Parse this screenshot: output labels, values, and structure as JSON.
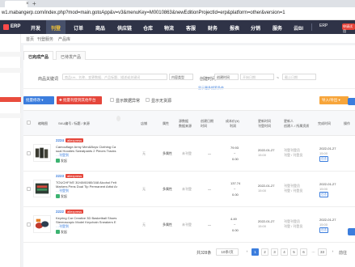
{
  "browser": {
    "close_glyph": "×",
    "new_tab_glyph": "+",
    "url": "w1.mabangerp.com/index.php?mod=main.gotoApp&v=v3&menuKey=M0010863&newEditionProjectId=erp&platform=other&version=1"
  },
  "topnav": {
    "logo": "ERP",
    "items": [
      "开发",
      "刊登",
      "订单",
      "商品",
      "供应链",
      "仓库",
      "物流",
      "客服",
      "财务",
      "报表",
      "分销",
      "服务",
      "云BI"
    ],
    "active_item": "刊登",
    "right_text": "ERP",
    "badge_text": "申请试用"
  },
  "breadcrumb": {
    "home": "首页",
    "section": "刊登服务",
    "page": "产品库"
  },
  "tabs": [
    "已完成产品",
    "已待发产品"
  ],
  "search": {
    "keyword_label": "商品关键词",
    "keyword_placeholder": "商品Url、名称、变更数据、产品标题、描述或关键词",
    "select_value": "内容类型",
    "time_label": "创建时间",
    "time_select": "创建时间",
    "date_start": "开始日期",
    "date_sep": "~",
    "date_end": "截止日期",
    "toggle_text": "显示更多搜索条件"
  },
  "toolbar": {
    "batch_label": "批量修改 ▾",
    "publish_label": "✚ 批量刊登到其他平台",
    "checkbox1_label": "显示数据异常",
    "checkbox2_label": "显示无货源",
    "right_label": "导入/导出 ▾"
  },
  "table": {
    "headers": {
      "image": "缩略图",
      "sku": "SKU编号 / 标题 / 来源",
      "platform": "店铺",
      "attr": "属性",
      "source_data_line1": "源数据",
      "source_data_line2": "数据来源",
      "created_line1": "创建日期",
      "created_line2": "时间",
      "cost_line1": "成本价(¥)",
      "cost_line2": "利润",
      "time_col_line1": "更新时间",
      "time_col_line2": "刊登时间",
      "updater_line1": "更新人",
      "updater_line2": "创建人 / 所属资质",
      "done_time": "完成时间",
      "ops": "操作"
    },
    "rows": [
      {
        "id": "2224",
        "tag": "aliexpress",
        "title_line1": "Camouflage Army Men&Boys Clothing Ca",
        "title_line2": "sual Hoodies Sweatpants 2 Pieces Tracks",
        "title_line3": "…刊登到",
        "store": "无",
        "attr": "多属性",
        "data_source": "未刊登",
        "cost_top": "79.93",
        "cost_mid": "~",
        "cost_bottom": "0.00",
        "update_date": "2022-01-27",
        "update_time": "15:00",
        "updater_line1": "刊登刊登员",
        "updater_line2": "刊登 / 刊登员",
        "done_date": "2022-01-27",
        "done_time": "15:00",
        "done_btn": "日志"
      },
      {
        "id": "2223",
        "tag": "aliexpress",
        "title_line1": "TOUCHFIVE 30/40/60/80/168 Alcohol Felt",
        "title_line2": "Markers Pens Dual Tip Permanent Artist Ar",
        "title_line3": "…刊登到",
        "store": "无",
        "attr": "多属性",
        "data_source": "未刊登",
        "cost_top": "137.74",
        "cost_mid": "~",
        "cost_bottom": "0.00",
        "update_date": "2022-01-27",
        "update_time": "15:00",
        "updater_line1": "刊登刊登员",
        "updater_line2": "刊登 / 刊登员",
        "done_date": "2022-01-27",
        "done_time": "15:00",
        "done_btn": "日志"
      },
      {
        "id": "2222",
        "tag": "aliexpress",
        "title_line1": "Keyring Car Creative 3D Basketball Shoes",
        "title_line2": "Stereoscopic Model Keychain Sneakers E",
        "title_line3": "…刊登到",
        "store": "无",
        "attr": "多属性",
        "data_source": "未刊登",
        "cost_top": "4.49",
        "cost_mid": "~",
        "cost_bottom": "0.00",
        "update_date": "2022-01-27",
        "update_time": "15:00",
        "updater_line1": "刊登刊登员",
        "updater_line2": "刊登 / 刊登员",
        "done_date": "2022-01-27",
        "done_time": "15:00",
        "done_btn": "日志"
      }
    ],
    "row_extra_label": "发起"
  },
  "pagination": {
    "total": "共328条",
    "per_page": "10条/页",
    "prev": "‹",
    "pages": [
      "1",
      "2",
      "3",
      "4",
      "5",
      "6",
      "…",
      "33"
    ],
    "active_page": "1",
    "next": "›",
    "goto_label": "前往"
  },
  "colors": {
    "nav_bg": "#2f3347",
    "accent": "#3b7ddd",
    "red": "#e5463b",
    "orange": "#f7a53a"
  }
}
